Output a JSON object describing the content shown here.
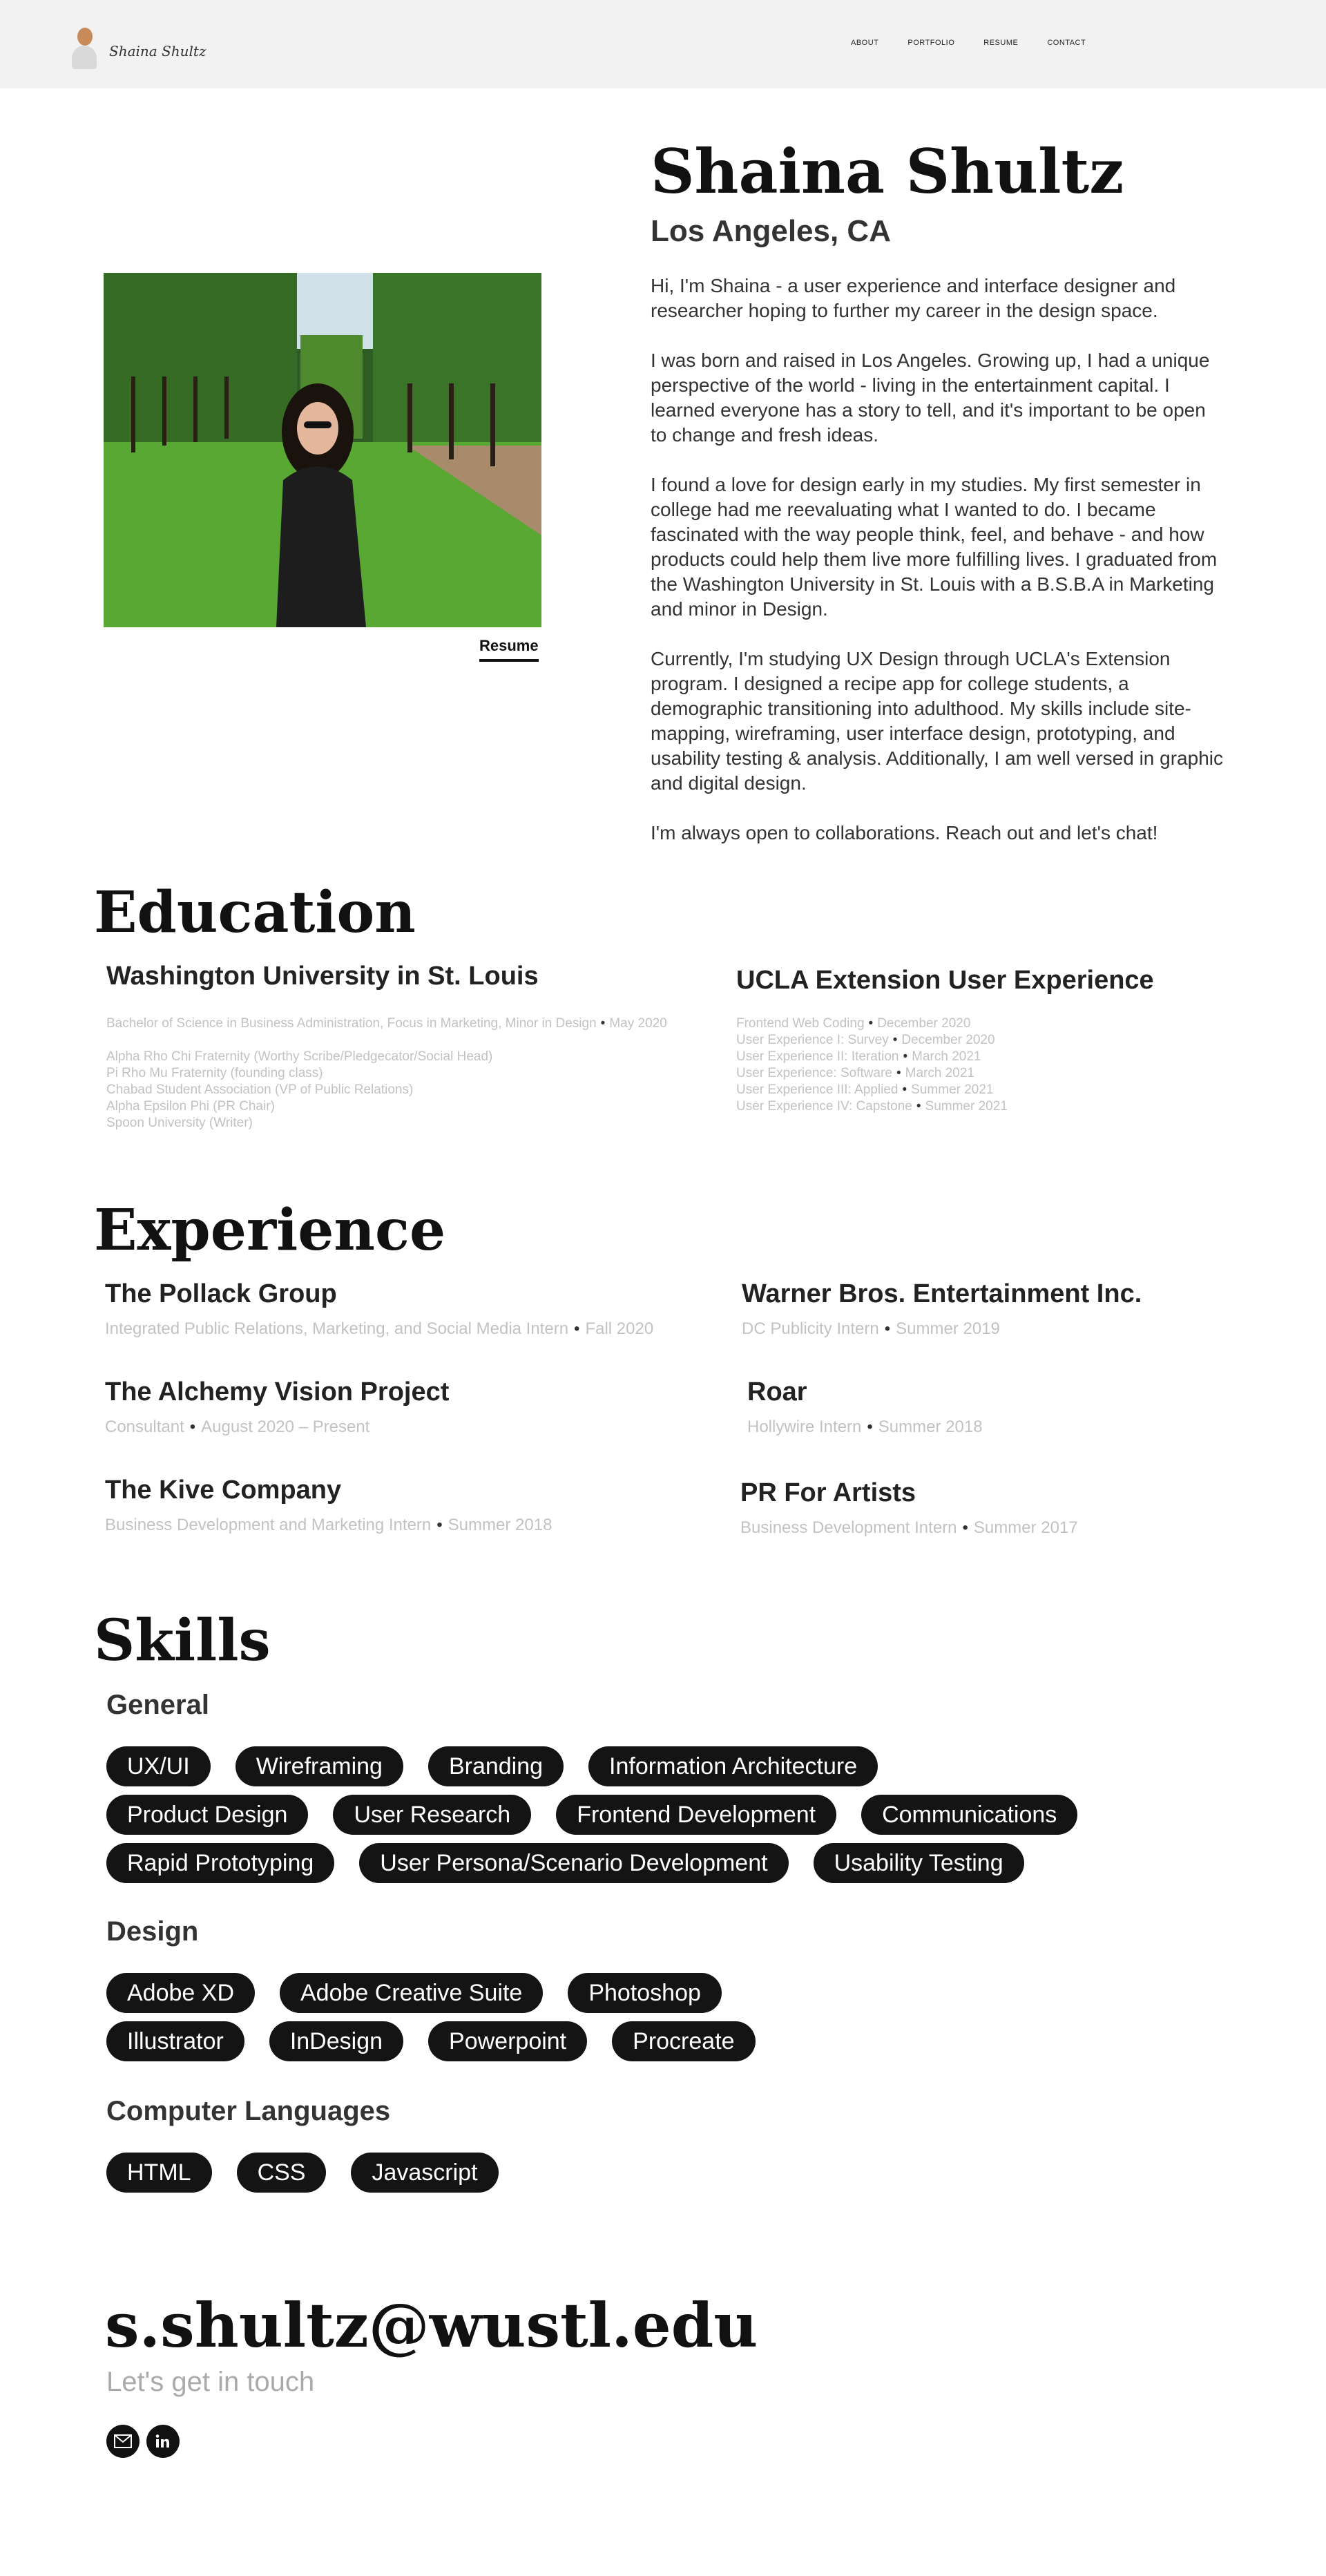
{
  "header": {
    "logo_text": "Shaina Shultz",
    "nav": [
      "ABOUT",
      "PORTFOLIO",
      "RESUME",
      "CONTACT"
    ]
  },
  "intro": {
    "name": "Shaina Shultz",
    "location": "Los Angeles, CA",
    "resume_link": "Resume",
    "paragraphs": [
      "Hi, I'm Shaina - a user experience and interface designer and researcher hoping to further my career in the design space.",
      "I was born and raised in Los Angeles. Growing up, I had a unique perspective of the world - living in the entertainment capital. I learned everyone has a story to tell, and it's important to be open to change and fresh ideas.",
      "I found a love for design early in my studies. My first semester in college had me reevaluating what I wanted to do. I became fascinated with the way people think, feel, and behave - and how products could help them live more fulfilling lives. I graduated from the Washington University in St. Louis with a B.S.B.A in Marketing and minor in Design.",
      "Currently, I'm studying UX Design through UCLA's Extension program. I designed a recipe app for college students, a demographic transitioning into adulthood. My skills include site-mapping, wireframing, user interface design, prototyping, and usability testing & analysis. Additionally, I am well versed in graphic and digital design.",
      "I'm always open to collaborations. Reach out and let's chat!"
    ]
  },
  "education": {
    "title": "Education",
    "schools": [
      {
        "name": "Washington University in St. Louis",
        "lines": [
          {
            "text": "Bachelor of Science in Business Administration, Focus in Marketing, Minor in Design",
            "date": "May 2020"
          },
          {
            "text": "",
            "date": ""
          },
          {
            "text": "Alpha Rho Chi Fraternity (Worthy Scribe/Pledgecator/Social Head)",
            "date": ""
          },
          {
            "text": "Pi Rho Mu Fraternity (founding class)",
            "date": ""
          },
          {
            "text": "Chabad Student Association (VP of Public Relations)",
            "date": ""
          },
          {
            "text": "Alpha Epsilon Phi (PR Chair)",
            "date": ""
          },
          {
            "text": "Spoon University (Writer)",
            "date": ""
          }
        ]
      },
      {
        "name": "UCLA Extension User Experience",
        "lines": [
          {
            "text": "Frontend Web Coding",
            "date": "December 2020"
          },
          {
            "text": "User Experience I: Survey",
            "date": "December 2020"
          },
          {
            "text": "User Experience II: Iteration",
            "date": "March 2021"
          },
          {
            "text": "User Experience: Software",
            "date": "March 2021"
          },
          {
            "text": "User Experience III: Applied",
            "date": "Summer 2021"
          },
          {
            "text": "User Experience IV: Capstone",
            "date": "Summer 2021"
          }
        ]
      }
    ]
  },
  "experience": {
    "title": "Experience",
    "jobs": [
      {
        "company": "The Pollack Group",
        "role": "Integrated Public Relations, Marketing, and Social Media Intern",
        "date": "Fall 2020"
      },
      {
        "company": "Warner Bros. Entertainment Inc.",
        "role": "DC Publicity Intern",
        "date": "Summer 2019"
      },
      {
        "company": "The Alchemy Vision Project",
        "role": "Consultant",
        "date": "August 2020 – Present"
      },
      {
        "company": "Roar",
        "role": "Hollywire Intern",
        "date": "Summer 2018"
      },
      {
        "company": "The Kive Company",
        "role": "Business Development and Marketing Intern",
        "date": "Summer 2018"
      },
      {
        "company": "PR For Artists",
        "role": "Business Development Intern",
        "date": "Summer 2017"
      }
    ]
  },
  "skills": {
    "title": "Skills",
    "groups": [
      {
        "name": "General",
        "rows": [
          [
            "UX/UI",
            "Wireframing",
            "Branding",
            "Information Architecture"
          ],
          [
            "Product Design",
            "User Research",
            "Frontend Development",
            "Communications"
          ],
          [
            "Rapid Prototyping",
            "User Persona/Scenario Development",
            "Usability Testing"
          ]
        ]
      },
      {
        "name": "Design",
        "rows": [
          [
            "Adobe XD",
            "Adobe Creative Suite",
            "Photoshop"
          ],
          [
            "Illustrator",
            "InDesign",
            "Powerpoint",
            "Procreate"
          ]
        ]
      },
      {
        "name": "Computer Languages",
        "rows": [
          [
            "HTML",
            "CSS",
            "Javascript"
          ]
        ]
      }
    ]
  },
  "contact": {
    "email": "s.shultz@wustl.edu",
    "tagline": "Let's get in touch",
    "icons": [
      "mail-icon",
      "linkedin-icon"
    ]
  },
  "colors": {
    "header_bg": "#f2f2f2",
    "pill_bg": "#141414",
    "meta_gray": "#c2c2c2"
  }
}
